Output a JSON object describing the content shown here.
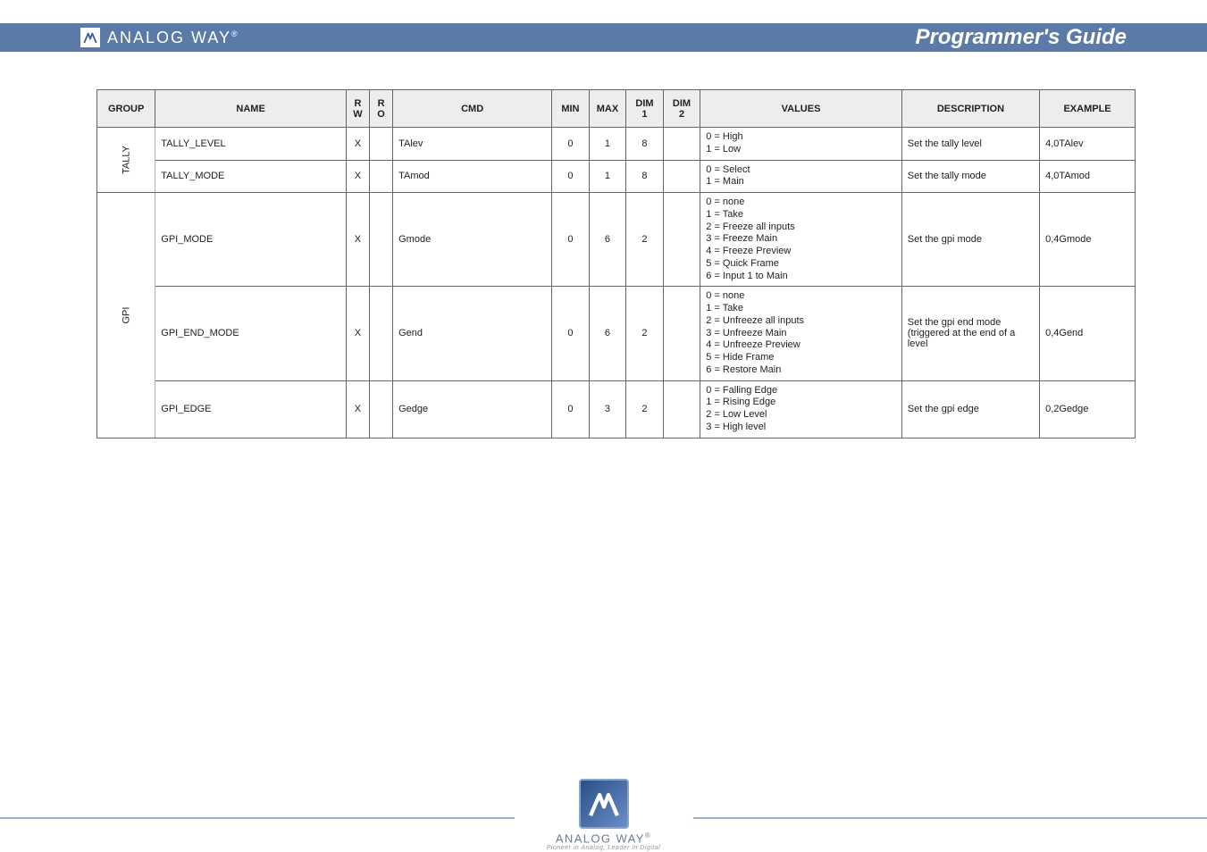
{
  "brand": {
    "name": "ANALOG WAY",
    "registered": "®"
  },
  "header": {
    "title": "Programmer's Guide"
  },
  "footer": {
    "brand": "ANALOG WAY",
    "registered": "®",
    "tagline": "Pioneer in Analog, Leader in Digital"
  },
  "table": {
    "headers": {
      "group": "GROUP",
      "name": "NAME",
      "rw": "R\nW",
      "ro": "R\nO",
      "cmd": "CMD",
      "min": "MIN",
      "max": "MAX",
      "dim1": "DIM\n1",
      "dim2": "DIM\n2",
      "values": "VALUES",
      "description": "DESCRIPTION",
      "example": "EXAMPLE"
    },
    "rows": [
      {
        "group": "TALLY",
        "groupRowspan": 2,
        "name": "TALLY_LEVEL",
        "rw": "X",
        "ro": "",
        "cmd": "TAlev",
        "min": "0",
        "max": "1",
        "dim1": "8",
        "dim2": "",
        "values": [
          "0 = High",
          "1 = Low"
        ],
        "description": "Set the tally level",
        "example": "4,0TAlev"
      },
      {
        "name": "TALLY_MODE",
        "rw": "X",
        "ro": "",
        "cmd": "TAmod",
        "min": "0",
        "max": "1",
        "dim1": "8",
        "dim2": "",
        "values": [
          "0 = Select",
          "1 = Main"
        ],
        "description": "Set the tally mode",
        "example": "4,0TAmod"
      },
      {
        "group": "GPI",
        "groupRowspan": 3,
        "name": "GPI_MODE",
        "rw": "X",
        "ro": "",
        "cmd": "Gmode",
        "min": "0",
        "max": "6",
        "dim1": "2",
        "dim2": "",
        "values": [
          "0 = none",
          "1 = Take",
          "2 = Freeze all inputs",
          "3 = Freeze Main",
          "4 = Freeze Preview",
          "5 = Quick Frame",
          "6 = Input 1 to Main"
        ],
        "description": "Set the gpi mode",
        "example": "0,4Gmode"
      },
      {
        "name": "GPI_END_MODE",
        "rw": "X",
        "ro": "",
        "cmd": "Gend",
        "min": "0",
        "max": "6",
        "dim1": "2",
        "dim2": "",
        "values": [
          "0 = none",
          "1 = Take",
          "2 = Unfreeze all inputs",
          "3 = Unfreeze Main",
          "4 = Unfreeze Preview",
          "5 = Hide Frame",
          "6 = Restore Main"
        ],
        "description": "Set the gpi end mode (triggered at the end of a level",
        "example": "0,4Gend"
      },
      {
        "name": "GPI_EDGE",
        "rw": "X",
        "ro": "",
        "cmd": "Gedge",
        "min": "0",
        "max": "3",
        "dim1": "2",
        "dim2": "",
        "values": [
          "0 = Falling Edge",
          "1 = Rising Edge",
          "2 = Low Level",
          "3 = High level"
        ],
        "description": "Set the gpi edge",
        "example": "0,2Gedge"
      }
    ]
  }
}
